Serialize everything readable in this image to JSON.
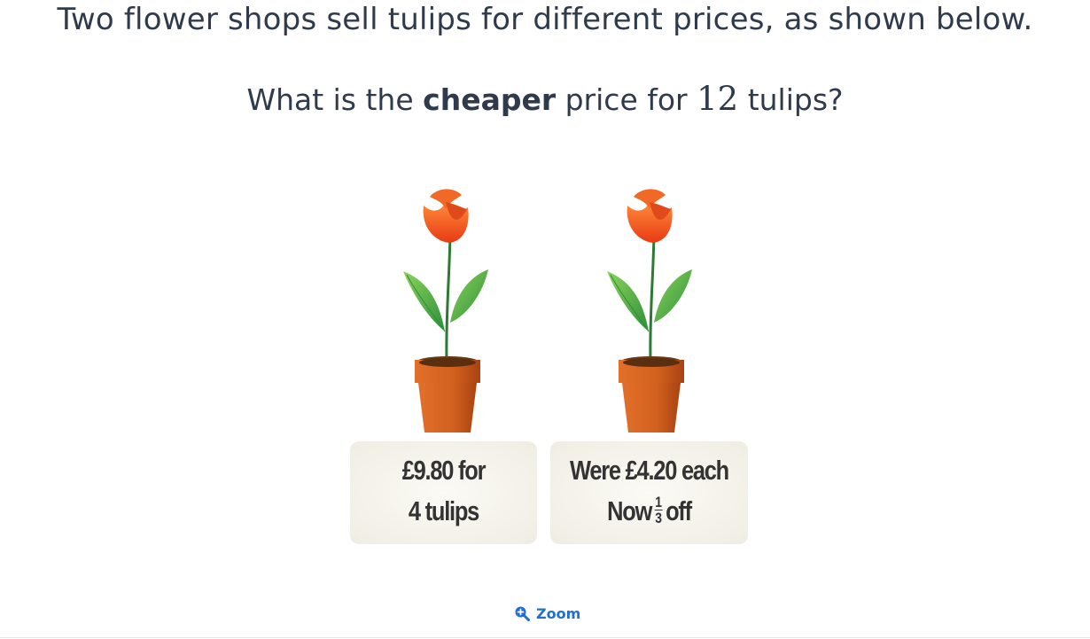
{
  "question": {
    "line1": "Two flower shops sell tulips for different prices, as shown below.",
    "line2_before": "What is the ",
    "line2_bold": "cheaper",
    "line2_middle": " price for ",
    "line2_number": "12",
    "line2_after": " tulips?"
  },
  "shop1": {
    "price_line1": "£9.80 for",
    "price_line2": "4 tulips"
  },
  "shop2": {
    "price_line1": "Were £4.20 each",
    "price_now": "Now",
    "fraction_numerator": "1",
    "fraction_denominator": "3",
    "price_off": "off"
  },
  "zoom": {
    "label": "Zoom",
    "icon": "zoom-in-icon"
  },
  "colors": {
    "text": "#2f3b4c",
    "link": "#1e6fd1",
    "petal": "#f0501e",
    "leaf": "#4fb64a",
    "pot": "#d2601e",
    "card": "#f3f1e8"
  }
}
